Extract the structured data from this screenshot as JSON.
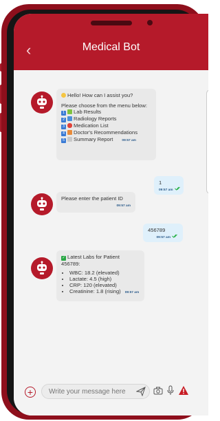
{
  "header": {
    "title": "Medical Bot",
    "back_icon": "‹"
  },
  "messages": {
    "m1": {
      "greeting": "Hello! How can I assist you?",
      "prompt": "Please choose from the menu below:",
      "menu": [
        {
          "num": "1",
          "label": "Lab Results"
        },
        {
          "num": "2",
          "label": "Radiology Reports"
        },
        {
          "num": "3",
          "label": "Medication List"
        },
        {
          "num": "4",
          "label": "Doctor's Recommendations"
        },
        {
          "num": "5",
          "label": "Summary Report"
        }
      ],
      "time": "09:57 am"
    },
    "m2": {
      "text": "1",
      "time": "09:57 am"
    },
    "m3": {
      "text": "Please enter the patient ID",
      "time": "09:57 am"
    },
    "m4": {
      "text": "456789",
      "time": "09:57 am"
    },
    "m5": {
      "title": "Latest Labs for Patient 456789:",
      "items": [
        "WBC: 18.2 (elevated)",
        "Lactate: 4.5 (high)",
        "CRP: 120 (elevated)",
        "Creatinine: 1.8 (rising)"
      ],
      "time": "09:57 am"
    }
  },
  "composer": {
    "placeholder": "Write your message here"
  },
  "colors": {
    "brand": "#b51a2a",
    "frame": "#8e0f1c",
    "read_check": "#2bb34a",
    "warning": "#c81d25"
  },
  "icons": [
    "back-icon",
    "robot-avatar-icon",
    "plus-icon",
    "send-icon",
    "camera-icon",
    "microphone-icon",
    "warning-icon"
  ]
}
